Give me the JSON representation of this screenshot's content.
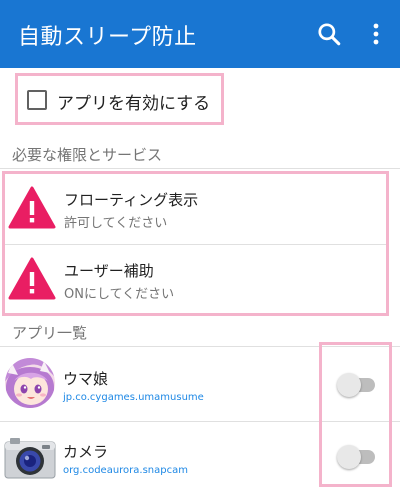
{
  "appbar": {
    "title": "自動スリープ防止",
    "background": "#1976d2",
    "search_icon": "search-icon",
    "more_icon": "more-vert-icon"
  },
  "enable": {
    "label": "アプリを有効にする",
    "checked": false
  },
  "permissions": {
    "header": "必要な権限とサービス",
    "items": [
      {
        "title": "フローティング表示",
        "subtitle": "許可してください",
        "icon": "warning-icon"
      },
      {
        "title": "ユーザー補助",
        "subtitle": "ONにしてください",
        "icon": "warning-icon"
      }
    ]
  },
  "apps": {
    "header": "アプリ一覧",
    "items": [
      {
        "name": "ウマ娘",
        "package": "jp.co.cygames.umamusume",
        "enabled": false
      },
      {
        "name": "カメラ",
        "package": "org.codeaurora.snapcam",
        "enabled": false
      }
    ]
  },
  "colors": {
    "highlight": "#f4b3cb",
    "warning": "#e91e63",
    "package_text": "#1e88e5"
  }
}
